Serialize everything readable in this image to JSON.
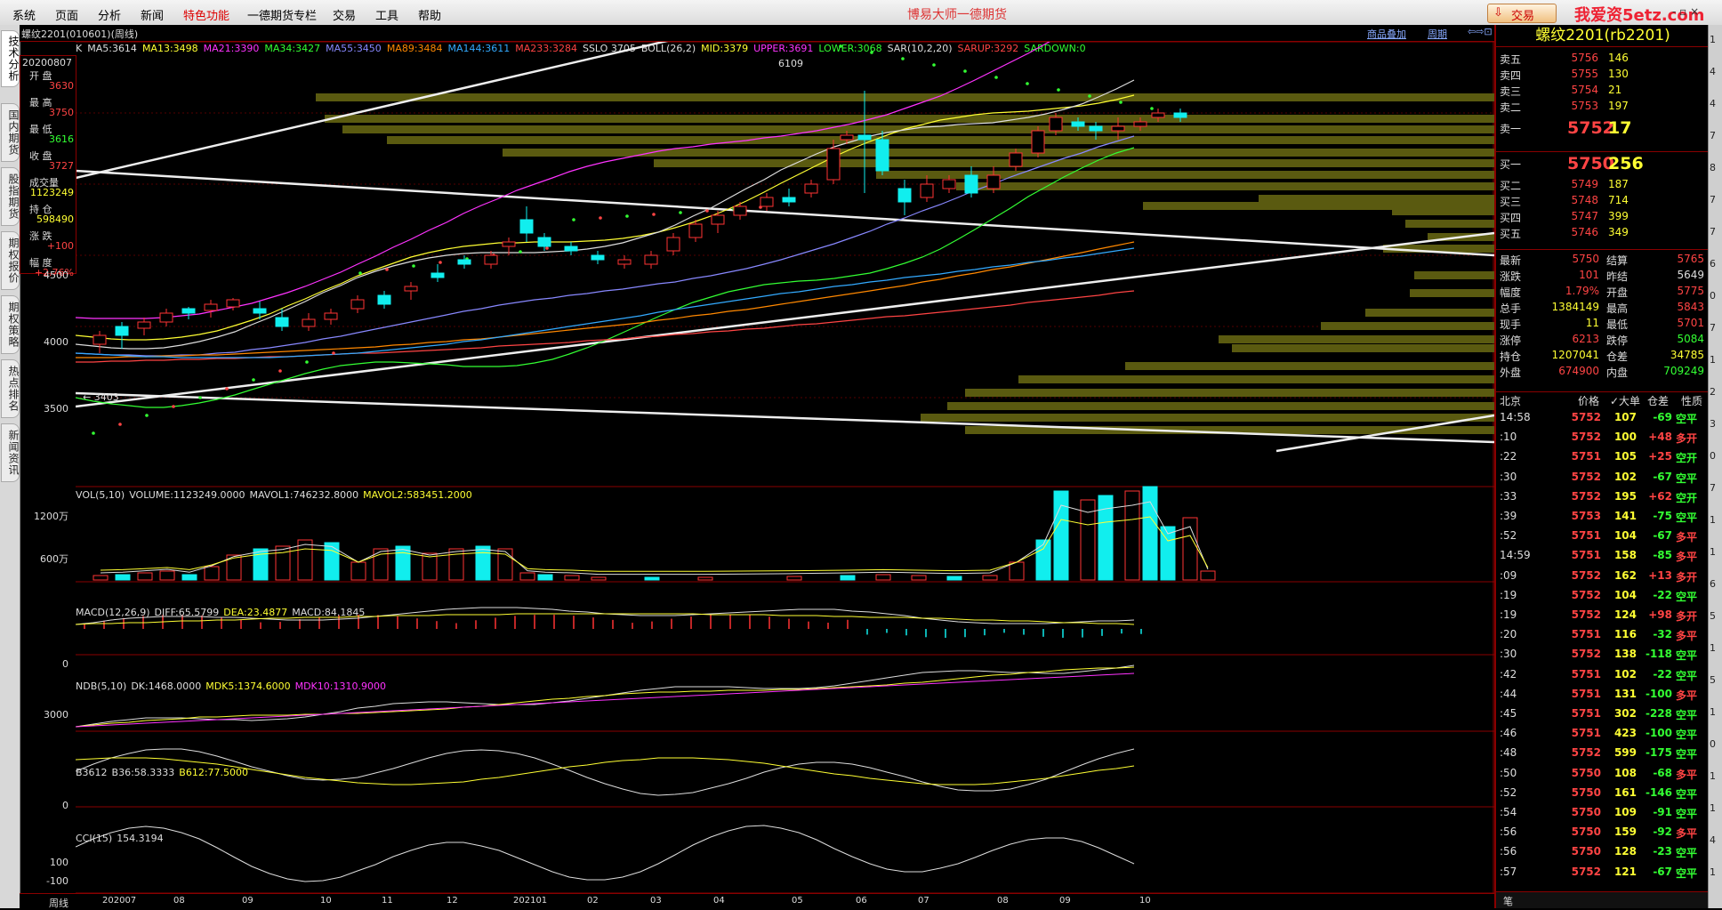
{
  "menu": {
    "items": [
      "系统",
      "页面",
      "分析",
      "新闻",
      "特色功能",
      "一德期货专栏",
      "交易",
      "工具",
      "帮助"
    ],
    "app_title": "博易大师一德期货",
    "trade_button": "交易",
    "watermark": "我爱资5etz.com",
    "win_controls": "- ▫ ×"
  },
  "left_tabs": [
    "技术分析",
    "国内期货",
    "股指期货",
    "期权报价",
    "期权策略",
    "热点排名",
    "新闻资讯"
  ],
  "chart": {
    "title": "螺纹2201(010601)(周线)",
    "overlay_button": "商品叠加",
    "period_button": "周期",
    "nav_buttons": "⇦⇨⊡",
    "info_box": {
      "date": "20200807",
      "rows": [
        {
          "label": "开 盘",
          "value": "3630",
          "color": "#f44"
        },
        {
          "label": "最 高",
          "value": "3750",
          "color": "#f44"
        },
        {
          "label": "最 低",
          "value": "3616",
          "color": "#3f3"
        },
        {
          "label": "收 盘",
          "value": "3727",
          "color": "#f44"
        },
        {
          "label": "成交量",
          "value": "1123249",
          "color": "#ff3"
        },
        {
          "label": "持 仓",
          "value": "598490",
          "color": "#ff3"
        },
        {
          "label": "涨 跌",
          "value": "+100",
          "color": "#f44"
        },
        {
          "label": "幅 度",
          "value": "+2.76%",
          "color": "#f44"
        }
      ]
    },
    "indicators": [
      {
        "text": "K",
        "color": "#ddd"
      },
      {
        "text": "MA5:3614",
        "color": "#ddd"
      },
      {
        "text": "MA13:3498",
        "color": "#ff3"
      },
      {
        "text": "MA21:3390",
        "color": "#f3f"
      },
      {
        "text": "MA34:3427",
        "color": "#3f3"
      },
      {
        "text": "MA55:3450",
        "color": "#88f"
      },
      {
        "text": "MA89:3484",
        "color": "#f80"
      },
      {
        "text": "MA144:3611",
        "color": "#3af"
      },
      {
        "text": "MA233:3284",
        "color": "#f44"
      },
      {
        "text": "SSLO 3705",
        "color": "#ddd"
      },
      {
        "text": "BOLL(26,2)",
        "color": "#ddd"
      },
      {
        "text": "MID:3379",
        "color": "#ff3"
      },
      {
        "text": "UPPER:3691",
        "color": "#f3f"
      },
      {
        "text": "LOWER:3068",
        "color": "#3f3"
      },
      {
        "text": "SAR(10,2,20)",
        "color": "#ddd"
      },
      {
        "text": "SARUP:3292",
        "color": "#f44"
      },
      {
        "text": "SARDOWN:0",
        "color": "#3f3"
      }
    ],
    "y_ticks": [
      "4500",
      "4000",
      "3500"
    ],
    "high_label": "6109",
    "low_label": "← 3403",
    "x_label": "周线",
    "x_ticks": [
      "202007",
      "08",
      "09",
      "10",
      "11",
      "12",
      "202101",
      "02",
      "03",
      "04",
      "05",
      "06",
      "07",
      "08",
      "09",
      "10"
    ],
    "vol": {
      "labels": [
        {
          "text": "VOL(5,10)",
          "color": "#ddd"
        },
        {
          "text": "VOLUME:1123249.0000",
          "color": "#ddd"
        },
        {
          "text": "MAVOL1:746232.8000",
          "color": "#ddd"
        },
        {
          "text": "MAVOL2:583451.2000",
          "color": "#ff3"
        }
      ],
      "ticks": [
        "1200万",
        "600万"
      ]
    },
    "macd": {
      "labels": [
        {
          "text": "MACD(12,26,9)",
          "color": "#ddd"
        },
        {
          "text": "DIFF:65.5799",
          "color": "#ddd"
        },
        {
          "text": "DEA:23.4877",
          "color": "#ff3"
        },
        {
          "text": "MACD:84.1845",
          "color": "#ddd"
        }
      ],
      "ticks": [
        "0"
      ]
    },
    "ndb": {
      "labels": [
        {
          "text": "NDB(5,10)",
          "color": "#ddd"
        },
        {
          "text": "DK:1468.0000",
          "color": "#ddd"
        },
        {
          "text": "MDK5:1374.6000",
          "color": "#ff3"
        },
        {
          "text": "MDK10:1310.9000",
          "color": "#f3f"
        }
      ],
      "ticks": [
        "3000"
      ]
    },
    "b3612": {
      "labels": [
        {
          "text": "B3612",
          "color": "#ddd"
        },
        {
          "text": "B36:58.3333",
          "color": "#ddd"
        },
        {
          "text": "B612:77.5000",
          "color": "#ff3"
        }
      ],
      "ticks": [
        "0"
      ]
    },
    "cci": {
      "labels": [
        {
          "text": "CCI(15)",
          "color": "#ddd"
        },
        {
          "text": "154.3194",
          "color": "#ddd"
        }
      ],
      "ticks": [
        "100",
        "-100"
      ]
    }
  },
  "right_panel": {
    "title": "螺纹2201(rb2201)",
    "asks": [
      {
        "label": "卖五",
        "price": "5756",
        "vol": "146"
      },
      {
        "label": "卖四",
        "price": "5755",
        "vol": "130"
      },
      {
        "label": "卖三",
        "price": "5754",
        "vol": "21"
      },
      {
        "label": "卖二",
        "price": "5753",
        "vol": "197"
      },
      {
        "label": "卖一",
        "price": "5752",
        "vol": "17"
      }
    ],
    "bids": [
      {
        "label": "买一",
        "price": "5750",
        "vol": "256"
      },
      {
        "label": "买二",
        "price": "5749",
        "vol": "187"
      },
      {
        "label": "买三",
        "price": "5748",
        "vol": "714"
      },
      {
        "label": "买四",
        "price": "5747",
        "vol": "399"
      },
      {
        "label": "买五",
        "price": "5746",
        "vol": "349"
      }
    ],
    "quotes": [
      {
        "l1": "最新",
        "v1": "5750",
        "c1": "#f44",
        "l2": "结算",
        "v2": "5765",
        "c2": "#f44"
      },
      {
        "l1": "涨跌",
        "v1": "101",
        "c1": "#f44",
        "l2": "昨结",
        "v2": "5649",
        "c2": "#ddd"
      },
      {
        "l1": "幅度",
        "v1": "1.79%",
        "c1": "#f44",
        "l2": "开盘",
        "v2": "5775",
        "c2": "#f44"
      },
      {
        "l1": "总手",
        "v1": "1384149",
        "c1": "#ff3",
        "l2": "最高",
        "v2": "5843",
        "c2": "#f44"
      },
      {
        "l1": "现手",
        "v1": "11",
        "c1": "#ff3",
        "l2": "最低",
        "v2": "5701",
        "c2": "#f44"
      },
      {
        "l1": "涨停",
        "v1": "6213",
        "c1": "#f44",
        "l2": "跌停",
        "v2": "5084",
        "c2": "#3f3"
      },
      {
        "l1": "持仓",
        "v1": "1207041",
        "c1": "#ff3",
        "l2": "仓差",
        "v2": "34785",
        "c2": "#ff3"
      },
      {
        "l1": "外盘",
        "v1": "674900",
        "c1": "#f44",
        "l2": "内盘",
        "v2": "709249",
        "c2": "#3f3"
      }
    ],
    "tick_header": {
      "city": "北京",
      "price": "价格",
      "vol": "✓大单",
      "diff": "仓差",
      "nature": "性质"
    },
    "ticks": [
      {
        "t": "14:58",
        "p": "5752",
        "pc": "#f44",
        "q": "107",
        "d": "-69",
        "dc": "#3f3",
        "n": "空平",
        "nc": "#3f3"
      },
      {
        "t": ":10",
        "p": "5752",
        "pc": "#f44",
        "q": "100",
        "d": "+48",
        "dc": "#f44",
        "n": "多开",
        "nc": "#f44"
      },
      {
        "t": ":22",
        "p": "5751",
        "pc": "#f44",
        "q": "105",
        "d": "+25",
        "dc": "#f44",
        "n": "空开",
        "nc": "#3f3"
      },
      {
        "t": ":30",
        "p": "5752",
        "pc": "#f44",
        "q": "102",
        "d": "-67",
        "dc": "#3f3",
        "n": "空平",
        "nc": "#3f3"
      },
      {
        "t": ":33",
        "p": "5752",
        "pc": "#f44",
        "q": "195",
        "d": "+62",
        "dc": "#f44",
        "n": "空开",
        "nc": "#3f3"
      },
      {
        "t": ":39",
        "p": "5753",
        "pc": "#f44",
        "q": "141",
        "d": "-75",
        "dc": "#3f3",
        "n": "空平",
        "nc": "#3f3"
      },
      {
        "t": ":52",
        "p": "5751",
        "pc": "#f44",
        "q": "104",
        "d": "-67",
        "dc": "#3f3",
        "n": "多平",
        "nc": "#f44"
      },
      {
        "t": "14:59",
        "p": "5751",
        "pc": "#f44",
        "q": "158",
        "d": "-85",
        "dc": "#3f3",
        "n": "多平",
        "nc": "#f44"
      },
      {
        "t": ":09",
        "p": "5752",
        "pc": "#f44",
        "q": "162",
        "d": "+13",
        "dc": "#f44",
        "n": "多开",
        "nc": "#f44"
      },
      {
        "t": ":19",
        "p": "5752",
        "pc": "#f44",
        "q": "104",
        "d": "-22",
        "dc": "#3f3",
        "n": "空平",
        "nc": "#3f3"
      },
      {
        "t": ":19",
        "p": "5752",
        "pc": "#f44",
        "q": "124",
        "d": "+98",
        "dc": "#f44",
        "n": "多开",
        "nc": "#f44"
      },
      {
        "t": ":20",
        "p": "5751",
        "pc": "#f44",
        "q": "116",
        "d": "-32",
        "dc": "#3f3",
        "n": "多平",
        "nc": "#f44"
      },
      {
        "t": ":30",
        "p": "5752",
        "pc": "#f44",
        "q": "138",
        "d": "-118",
        "dc": "#3f3",
        "n": "空平",
        "nc": "#3f3"
      },
      {
        "t": ":42",
        "p": "5751",
        "pc": "#f44",
        "q": "102",
        "d": "-22",
        "dc": "#3f3",
        "n": "空平",
        "nc": "#3f3"
      },
      {
        "t": ":44",
        "p": "5751",
        "pc": "#f44",
        "q": "131",
        "d": "-100",
        "dc": "#3f3",
        "n": "多平",
        "nc": "#f44"
      },
      {
        "t": ":45",
        "p": "5751",
        "pc": "#f44",
        "q": "302",
        "d": "-228",
        "dc": "#3f3",
        "n": "空平",
        "nc": "#3f3"
      },
      {
        "t": ":46",
        "p": "5751",
        "pc": "#f44",
        "q": "423",
        "d": "-100",
        "dc": "#3f3",
        "n": "空平",
        "nc": "#3f3"
      },
      {
        "t": ":48",
        "p": "5752",
        "pc": "#f44",
        "q": "599",
        "d": "-175",
        "dc": "#3f3",
        "n": "空平",
        "nc": "#3f3"
      },
      {
        "t": ":50",
        "p": "5750",
        "pc": "#f44",
        "q": "108",
        "d": "-68",
        "dc": "#3f3",
        "n": "多平",
        "nc": "#f44"
      },
      {
        "t": ":52",
        "p": "5750",
        "pc": "#f44",
        "q": "161",
        "d": "-146",
        "dc": "#3f3",
        "n": "空平",
        "nc": "#3f3"
      },
      {
        "t": ":54",
        "p": "5750",
        "pc": "#f44",
        "q": "109",
        "d": "-91",
        "dc": "#3f3",
        "n": "空平",
        "nc": "#3f3"
      },
      {
        "t": ":56",
        "p": "5750",
        "pc": "#f44",
        "q": "159",
        "d": "-92",
        "dc": "#3f3",
        "n": "多平",
        "nc": "#f44"
      },
      {
        "t": ":56",
        "p": "5750",
        "pc": "#f44",
        "q": "128",
        "d": "-23",
        "dc": "#3f3",
        "n": "空平",
        "nc": "#3f3"
      },
      {
        "t": ":57",
        "p": "5752",
        "pc": "#f44",
        "q": "121",
        "d": "-67",
        "dc": "#3f3",
        "n": "空平",
        "nc": "#3f3"
      }
    ],
    "footer": "笔"
  },
  "right_strip": [
    "1",
    "4",
    "4",
    "7",
    "8",
    "7",
    "7",
    "6",
    "0",
    "7",
    "1",
    "2",
    "3",
    "0",
    "7",
    "1",
    "1",
    "6",
    "5",
    "1",
    "5",
    "1",
    "0",
    "1",
    "1",
    "4",
    "1"
  ]
}
